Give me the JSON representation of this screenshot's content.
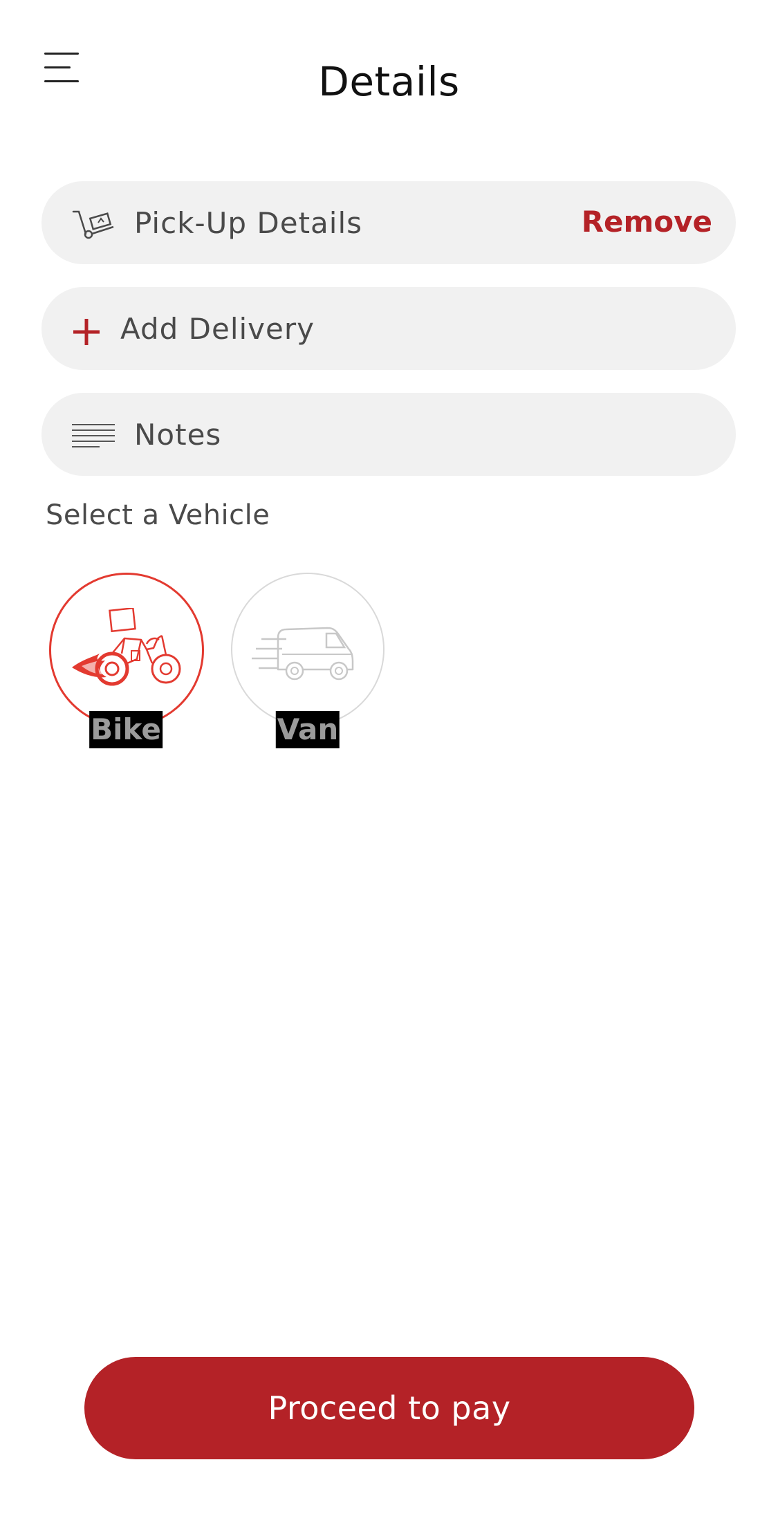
{
  "header": {
    "title": "Details",
    "menu_icon": "hamburger-menu-icon"
  },
  "pickup": {
    "label": "Pick-Up Details",
    "icon": "hand-truck-icon",
    "remove_label": "Remove"
  },
  "delivery": {
    "label": "Add Delivery",
    "icon": "plus-icon"
  },
  "notes": {
    "label": "Notes",
    "icon": "text-lines-icon"
  },
  "vehicles": {
    "title": "Select a Vehicle",
    "items": [
      {
        "label": "Bike",
        "icon": "motorbike-icon",
        "selected": true
      },
      {
        "label": "Van",
        "icon": "van-icon",
        "selected": false
      }
    ]
  },
  "footer": {
    "pay_label": "Proceed to pay"
  },
  "colors": {
    "accent": "#b42227",
    "selected_border": "#e33a30",
    "pill_bg": "#f1f1f1",
    "text": "#4a4a4a"
  }
}
